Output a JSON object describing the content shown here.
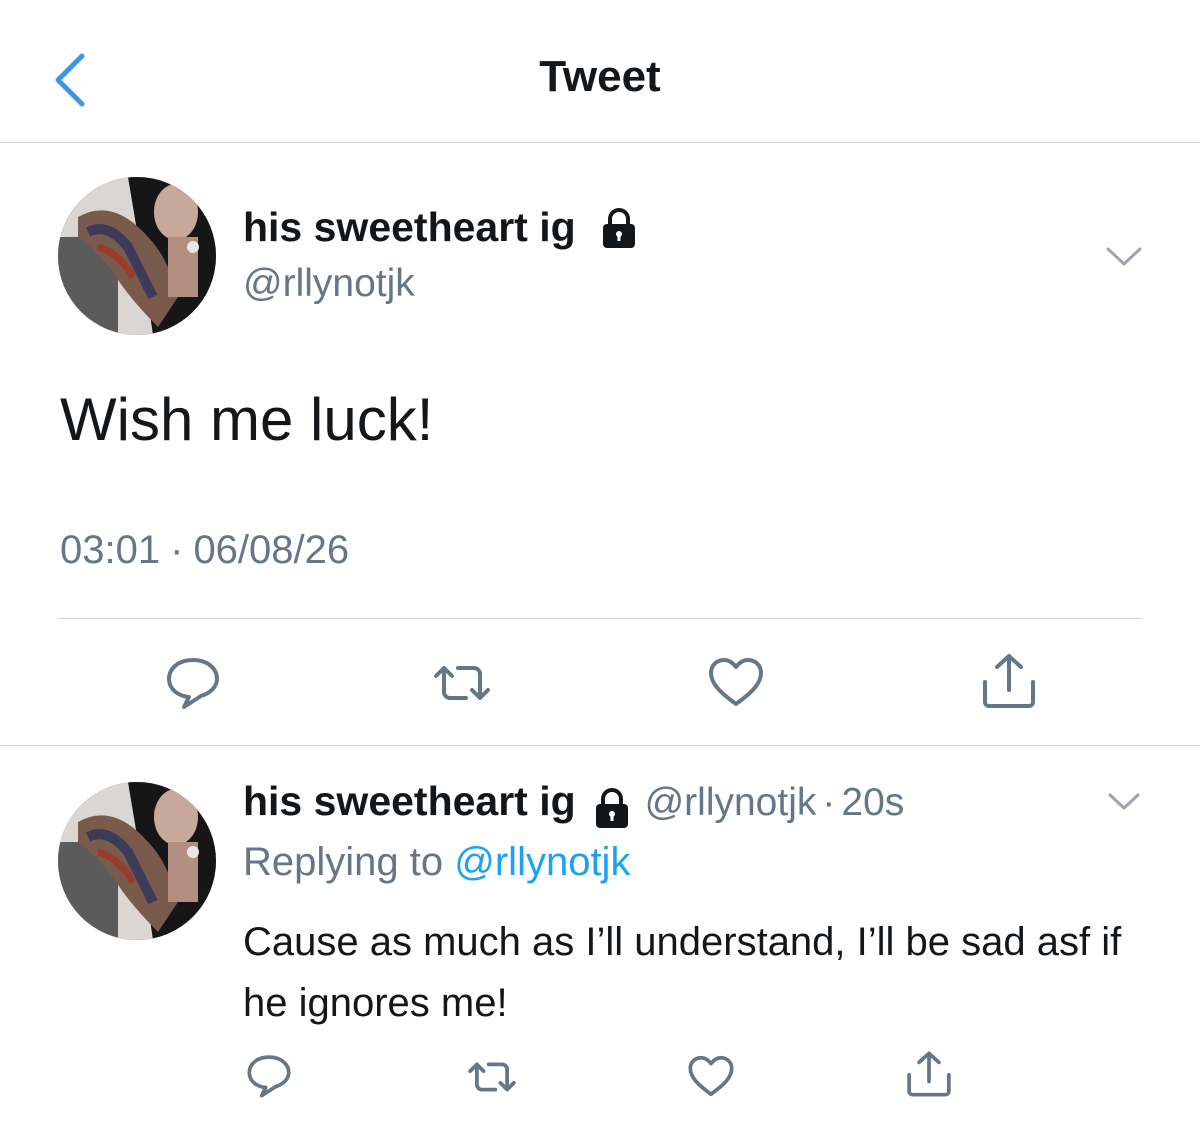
{
  "header": {
    "title": "Tweet",
    "back_icon": "chevron-left-icon",
    "accent": "#1da1f2"
  },
  "main_tweet": {
    "display_name": "his sweetheart ig",
    "handle": "@rllynotjk",
    "text": "Wish me luck!",
    "time": "03:01",
    "separator": "·",
    "date": "06/08/26",
    "actions": [
      "comment-icon",
      "retweet-icon",
      "heart-icon",
      "share-icon"
    ]
  },
  "reply_tweet": {
    "display_name": "his sweetheart ig",
    "handle": "@rllynotjk",
    "separator": "·",
    "age": "20s",
    "replying_label": "Replying to",
    "replying_handle": "@rllynotjk",
    "text": "Cause as much as I’ll understand, I’ll be sad asf if he ignores me!",
    "actions": [
      "comment-icon",
      "retweet-icon",
      "heart-icon",
      "share-icon"
    ]
  },
  "colors": {
    "text": "#14171a",
    "secondary": "#657786",
    "divider": "#cfd4d8",
    "link": "#1da1f2"
  }
}
